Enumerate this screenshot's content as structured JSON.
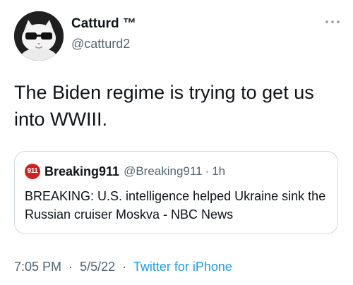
{
  "author": {
    "display_name": "Catturd ™",
    "handle": "@catturd2",
    "avatar_icon": "cat-with-sunglasses-avatar"
  },
  "more_icon": "more-horizontal-icon",
  "tweet": {
    "text": "The Biden regime is trying to get us\ninto WWIII."
  },
  "quote": {
    "avatar_text": "911",
    "display_name": "Breaking911",
    "handle": "@Breaking911",
    "separator": "·",
    "time": "1h",
    "text": "BREAKING: U.S. intelligence helped Ukraine sink the Russian cruiser Moskva - NBC News"
  },
  "footer": {
    "time": "7:05 PM",
    "date": "5/5/22",
    "separator": "·",
    "source": "Twitter for iPhone"
  },
  "colors": {
    "text_primary": "#0f1419",
    "text_secondary": "#536471",
    "link": "#1d9bf0",
    "border": "#cfd9de",
    "quote_avatar_bg": "#d32020"
  }
}
